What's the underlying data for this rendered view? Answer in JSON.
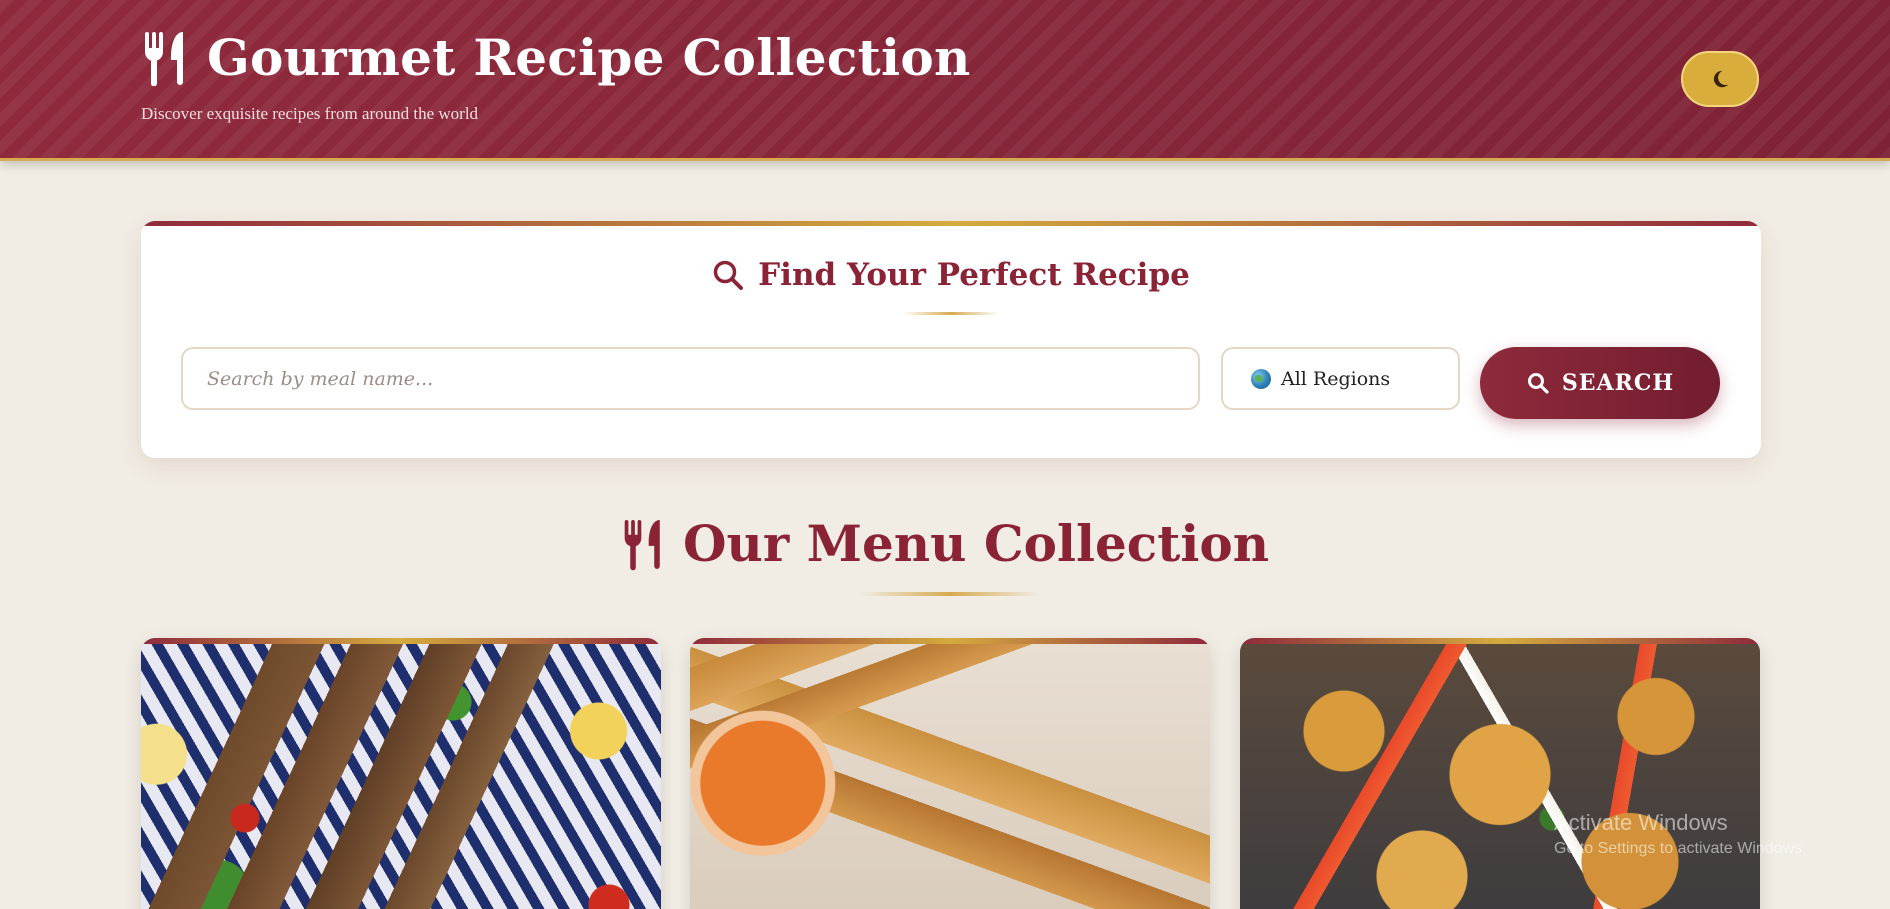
{
  "header": {
    "title": "Gourmet Recipe Collection",
    "subtitle": "Discover exquisite recipes from around the world",
    "title_icon": "utensils-icon",
    "theme_toggle_icon": "moon-icon"
  },
  "search": {
    "heading": "Find Your Perfect Recipe",
    "heading_icon": "search-icon",
    "input_placeholder": "Search by meal name...",
    "input_value": "",
    "region_selected": "All Regions",
    "region_icon": "globe-icon",
    "button_label": "SEARCH",
    "button_icon": "search-icon"
  },
  "menu": {
    "heading": "Our Menu Collection",
    "heading_icon": "utensils-icon",
    "cards": [
      {
        "image": "kofta-kebab-skewers-photo"
      },
      {
        "image": "spring-rolls-photo"
      },
      {
        "image": "spicy-potatoes-photo"
      }
    ]
  },
  "watermark": {
    "line1": "Activate Windows",
    "line2": "Go to Settings to activate Windows."
  },
  "colors": {
    "brand": "#8b2336",
    "accent_gold": "#d6ab4f",
    "background": "#f1ece4"
  }
}
